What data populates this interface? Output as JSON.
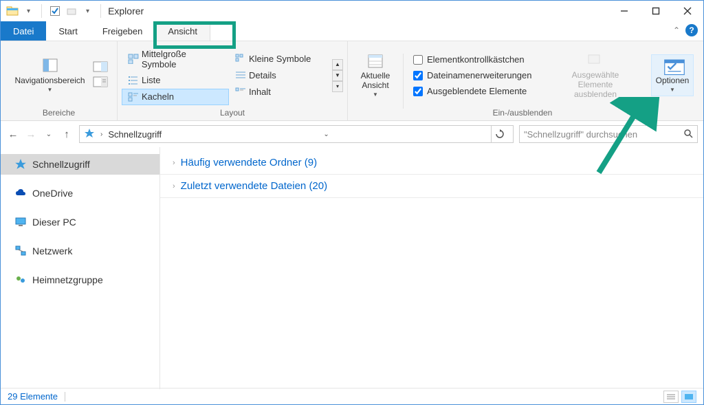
{
  "window": {
    "title": "Explorer"
  },
  "tabs": {
    "file": "Datei",
    "start": "Start",
    "share": "Freigeben",
    "view": "Ansicht"
  },
  "ribbon": {
    "panes_group": "Bereiche",
    "nav_pane": "Navigationsbereich",
    "layout_group": "Layout",
    "medium_icons": "Mittelgroße Symbole",
    "small_icons": "Kleine Symbole",
    "list": "Liste",
    "details": "Details",
    "tiles": "Kacheln",
    "content": "Inhalt",
    "current_view": "Aktuelle Ansicht",
    "show_hide_group": "Ein-/ausblenden",
    "item_checkboxes": "Elementkontrollkästchen",
    "file_ext": "Dateinamenerweiterungen",
    "hidden_items": "Ausgeblendete Elemente",
    "hide_selected_l1": "Ausgewählte",
    "hide_selected_l2": "Elemente ausblenden",
    "options": "Optionen"
  },
  "address": {
    "location": "Schnellzugriff",
    "search_placeholder": "\"Schnellzugriff\" durchsuchen"
  },
  "sidebar": {
    "quick_access": "Schnellzugriff",
    "onedrive": "OneDrive",
    "this_pc": "Dieser PC",
    "network": "Netzwerk",
    "homegroup": "Heimnetzgruppe"
  },
  "main": {
    "frequent_folders": "Häufig verwendete Ordner (9)",
    "recent_files": "Zuletzt verwendete Dateien (20)"
  },
  "status": {
    "items": "29 Elemente"
  },
  "checks": {
    "checkboxes": false,
    "extensions": true,
    "hidden": true
  }
}
